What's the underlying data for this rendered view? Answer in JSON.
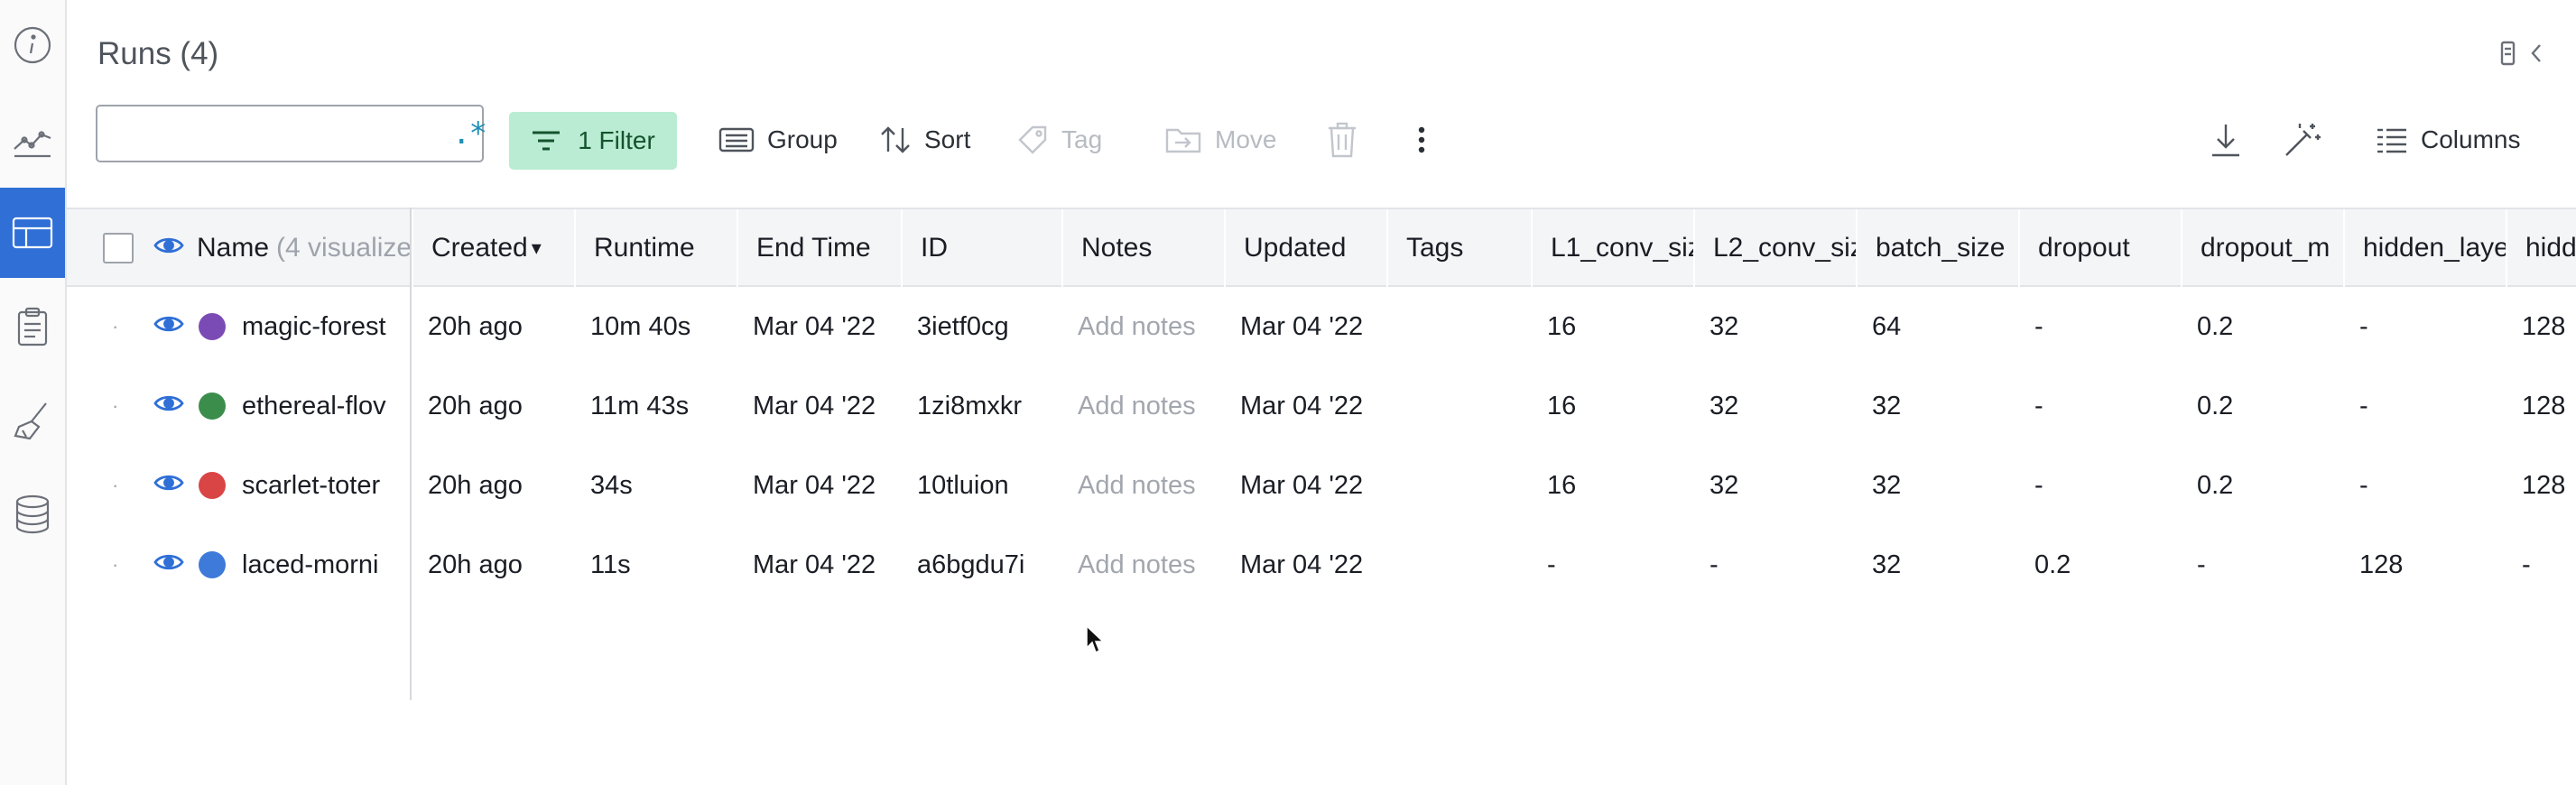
{
  "header": {
    "title": "Runs (4)"
  },
  "toolbar": {
    "search_placeholder": "",
    "regex_label": ".*",
    "filter_label": "1 Filter",
    "group_label": "Group",
    "sort_label": "Sort",
    "tag_label": "Tag",
    "move_label": "Move",
    "columns_label": "Columns"
  },
  "table": {
    "name_header": "Name",
    "name_header_note": "(4 visualize",
    "headers": [
      "Created",
      "Runtime",
      "End Time",
      "ID",
      "Notes",
      "Updated",
      "Tags",
      "L1_conv_siz",
      "L2_conv_siz",
      "batch_size",
      "dropout",
      "dropout_m",
      "hidden_laye",
      "hidde"
    ],
    "sort_indicator": "▾",
    "rows": [
      {
        "name": "magic-forest",
        "color": "#7b4bb5",
        "cells": [
          "20h ago",
          "10m 40s",
          "Mar 04 '22",
          "3ietf0cg",
          "Add notes",
          "Mar 04 '22",
          "",
          "16",
          "32",
          "64",
          "-",
          "0.2",
          "-",
          "128"
        ]
      },
      {
        "name": "ethereal-flov",
        "color": "#3b8d4c",
        "cells": [
          "20h ago",
          "11m 43s",
          "Mar 04 '22",
          "1zi8mxkr",
          "Add notes",
          "Mar 04 '22",
          "",
          "16",
          "32",
          "32",
          "-",
          "0.2",
          "-",
          "128"
        ]
      },
      {
        "name": "scarlet-toter",
        "color": "#d94545",
        "cells": [
          "20h ago",
          "34s",
          "Mar 04 '22",
          "10tluion",
          "Add notes",
          "Mar 04 '22",
          "",
          "16",
          "32",
          "32",
          "-",
          "0.2",
          "-",
          "128"
        ]
      },
      {
        "name": "laced-morni",
        "color": "#3d7ad9",
        "cells": [
          "20h ago",
          "11s",
          "Mar 04 '22",
          "a6bgdu7i",
          "Add notes",
          "Mar 04 '22",
          "",
          "-",
          "-",
          "32",
          "0.2",
          "-",
          "128",
          "-"
        ]
      }
    ]
  },
  "colors": {
    "accent": "#2f6fd6",
    "filter_bg": "#b9ecd2"
  },
  "icons": {
    "rail": [
      "info-icon",
      "chart-icon",
      "table-icon",
      "clipboard-icon",
      "broom-icon",
      "database-icon"
    ],
    "toolbar": [
      "search-icon",
      "filter-icon",
      "group-icon",
      "sort-icon",
      "tag-icon",
      "move-icon",
      "trash-icon",
      "more-icon",
      "download-icon",
      "magic-wand-icon",
      "columns-icon"
    ]
  }
}
